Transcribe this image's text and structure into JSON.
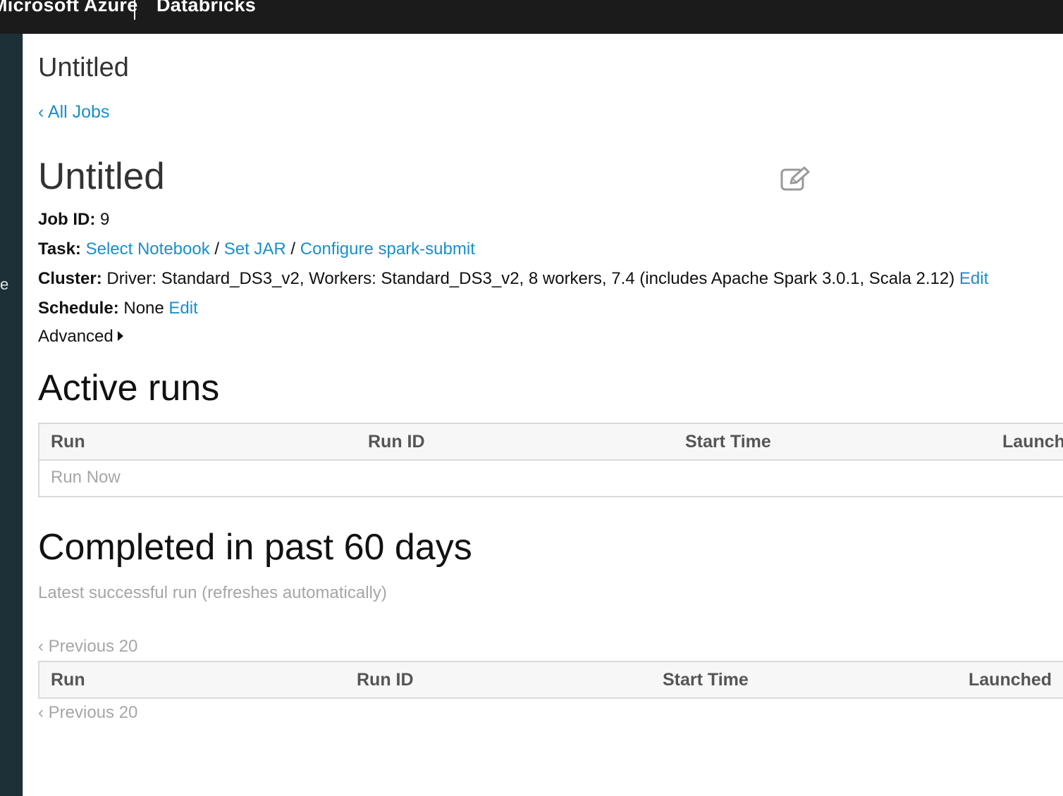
{
  "topbar": {
    "brand": "Microsoft Azure",
    "product": "Databricks"
  },
  "sidebar": {
    "fragment": "e"
  },
  "page": {
    "crumb_title": "Untitled",
    "back_link": "‹ All Jobs",
    "job_title": "Untitled",
    "edit_icon": "edit-pencil-icon"
  },
  "details": {
    "job_id_label": "Job ID:",
    "job_id_value": "9",
    "task_label": "Task:",
    "task_links": [
      "Select Notebook",
      "Set JAR",
      "Configure spark-submit"
    ],
    "task_separator": " / ",
    "cluster_label": "Cluster:",
    "cluster_value": "Driver: Standard_DS3_v2, Workers: Standard_DS3_v2, 8 workers, 7.4 (includes Apache Spark 3.0.1, Scala 2.12)",
    "cluster_edit": "Edit",
    "schedule_label": "Schedule:",
    "schedule_value": "None",
    "schedule_edit": "Edit",
    "advanced_label": "Advanced"
  },
  "active_runs": {
    "title": "Active runs",
    "columns": [
      "Run",
      "Run ID",
      "Start Time",
      "Launched"
    ],
    "run_now": "Run Now"
  },
  "completed": {
    "title": "Completed in past 60 days",
    "latest_note": "Latest successful run (refreshes automatically)",
    "prev_top": "‹ Previous 20",
    "columns": [
      "Run",
      "Run ID",
      "Start Time",
      "Launched"
    ],
    "prev_bottom": "‹ Previous 20"
  }
}
